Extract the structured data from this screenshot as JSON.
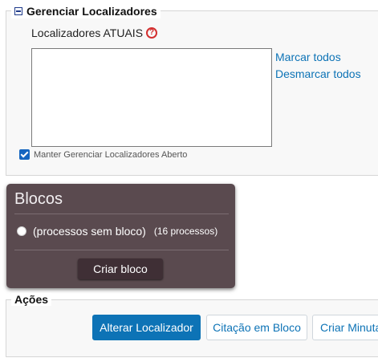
{
  "localizadores": {
    "legend": "Gerenciar Localizadores",
    "label": "Localizadores ATUAIS",
    "help_icon": "?",
    "mark_all": "Marcar todos",
    "unmark_all": "Desmarcar todos",
    "keep_open_label": "Manter Gerenciar Localizadores Aberto",
    "keep_open_checked": true
  },
  "blocos": {
    "title": "Blocos",
    "radio_label": "(processos sem bloco)",
    "radio_count": "(16 processos)",
    "create_button": "Criar bloco",
    "panel_color": "#5a4a4f"
  },
  "acoes": {
    "legend": "Ações",
    "buttons": [
      {
        "label": "Alterar Localizador"
      },
      {
        "label": "Citação em Bloco"
      },
      {
        "label": "Criar Minuta"
      }
    ],
    "primary_color": "#0d73b6"
  }
}
